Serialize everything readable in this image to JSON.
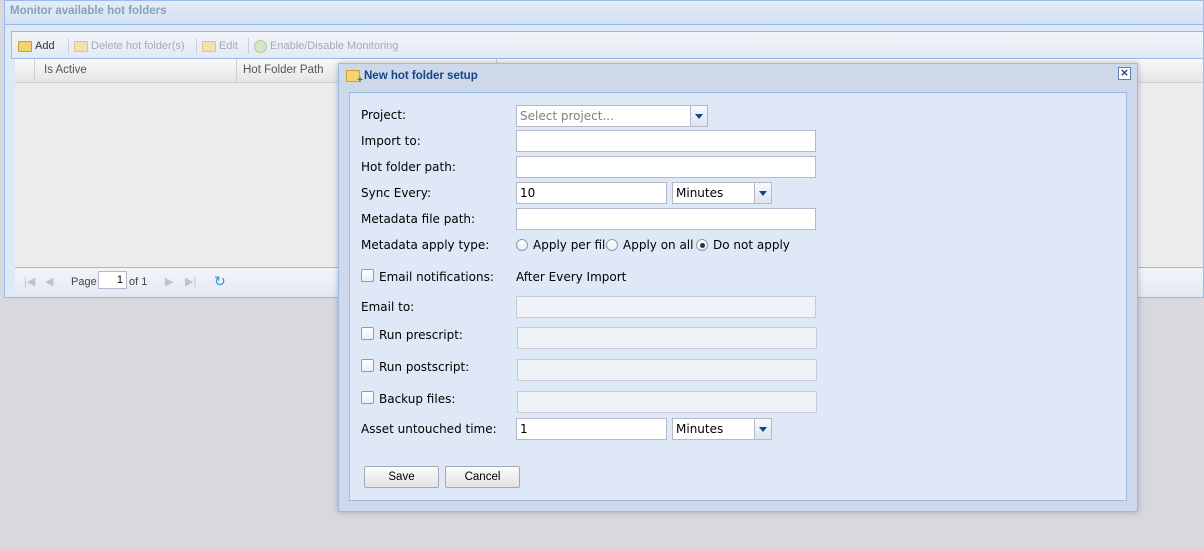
{
  "background": {
    "panel_title": "Monitor available hot folders",
    "toolbar": {
      "add_label": "Add",
      "delete_label": "Delete hot folder(s)",
      "edit_label": "Edit",
      "enable_disable_label": "Enable/Disable Monitoring"
    },
    "grid": {
      "columns": [
        "Is Active",
        "Hot Folder Path"
      ]
    },
    "pager": {
      "page_label": "Page",
      "page_value": "1",
      "of_label": "of 1"
    }
  },
  "dialog": {
    "title": "New hot folder setup",
    "fields": {
      "project_label": "Project:",
      "project_placeholder": "Select project...",
      "import_to_label": "Import to:",
      "import_to_value": "",
      "hot_folder_path_label": "Hot folder path:",
      "hot_folder_path_value": "",
      "sync_every_label": "Sync Every:",
      "sync_every_value": "10",
      "sync_every_unit": "Minutes",
      "metadata_file_path_label": "Metadata file path:",
      "metadata_file_path_value": "",
      "metadata_apply_type_label": "Metadata apply type:",
      "metadata_apply_options": [
        "Apply per file",
        "Apply on all",
        "Do not apply"
      ],
      "metadata_apply_selected": "Do not apply",
      "email_notifications_label": "Email notifications:",
      "email_notifications_text": "After Every Import",
      "email_to_label": "Email to:",
      "run_prescript_label": "Run prescript:",
      "run_postscript_label": "Run postscript:",
      "backup_files_label": "Backup files:",
      "asset_untouched_label": "Asset untouched time:",
      "asset_untouched_value": "1",
      "asset_untouched_unit": "Minutes"
    },
    "buttons": {
      "save_label": "Save",
      "cancel_label": "Cancel"
    }
  },
  "colors": {
    "title_text": "#15428b",
    "panel_border": "#99bbe8",
    "panel_background": "#dfe8f6"
  }
}
